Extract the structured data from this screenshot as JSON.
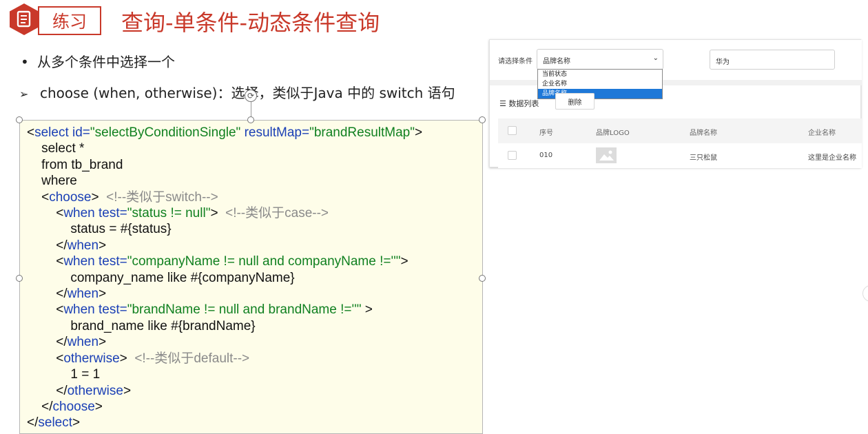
{
  "header": {
    "tag": "练习",
    "title": "查询-单条件-动态条件查询"
  },
  "bullets": {
    "item1": "从多个条件中选择一个",
    "item2": "choose (when, otherwise)：选择，类似于Java 中的 switch 语句"
  },
  "code": {
    "l1_a": "<",
    "l1_b": "select id=",
    "l1_c": "\"selectByConditionSingle\"",
    "l1_d": " resultMap=",
    "l1_e": "\"brandResultMap\"",
    "l1_f": ">",
    "l2": "    select *",
    "l3": "    from tb_brand",
    "l4": "    where",
    "l5_a": "    <",
    "l5_b": "choose",
    "l5_c": ">  ",
    "l5_d": "<!--类似于switch-->",
    "l6_a": "        <",
    "l6_b": "when test=",
    "l6_c": "\"status != null\"",
    "l6_d": ">  ",
    "l6_e": "<!--类似于case-->",
    "l7": "            status = #{status}",
    "l8_a": "        </",
    "l8_b": "when",
    "l8_c": ">",
    "l9_a": "        <",
    "l9_b": "when test=",
    "l9_c": "\"companyName != null and companyName !=''\"",
    "l9_d": ">",
    "l10": "            company_name like #{companyName}",
    "l11_a": "        </",
    "l11_b": "when",
    "l11_c": ">",
    "l12_a": "        <",
    "l12_b": "when test=",
    "l12_c": "\"brandName != null and brandName !=''\"",
    "l12_d": " >",
    "l13": "            brand_name like #{brandName}",
    "l14_a": "        </",
    "l14_b": "when",
    "l14_c": ">",
    "l15_a": "        <",
    "l15_b": "otherwise",
    "l15_c": ">  ",
    "l15_d": "<!--类似于default-->",
    "l16": "            1 = 1",
    "l17_a": "        </",
    "l17_b": "otherwise",
    "l17_c": ">",
    "l18_a": "    </",
    "l18_b": "choose",
    "l18_c": ">",
    "l19_a": "</",
    "l19_b": "select",
    "l19_c": ">"
  },
  "ui": {
    "filter_label": "请选择条件",
    "select_value": "品牌名称",
    "options": [
      "当前状态",
      "企业名称",
      "品牌名称"
    ],
    "search_value": "华为",
    "list_title": "数据列表",
    "delete_button": "删除",
    "columns": [
      "序号",
      "品牌LOGO",
      "品牌名称",
      "企业名称"
    ],
    "row": {
      "index": "010",
      "brand_name": "三只松鼠",
      "company_name": "这里是企业名称"
    }
  },
  "colors": {
    "accent": "#c9392a",
    "keyword": "#1a3fb5",
    "string": "#108020",
    "comment": "#8a8a8a",
    "code_bg": "#fefde9",
    "selected_option": "#1e78d8"
  }
}
